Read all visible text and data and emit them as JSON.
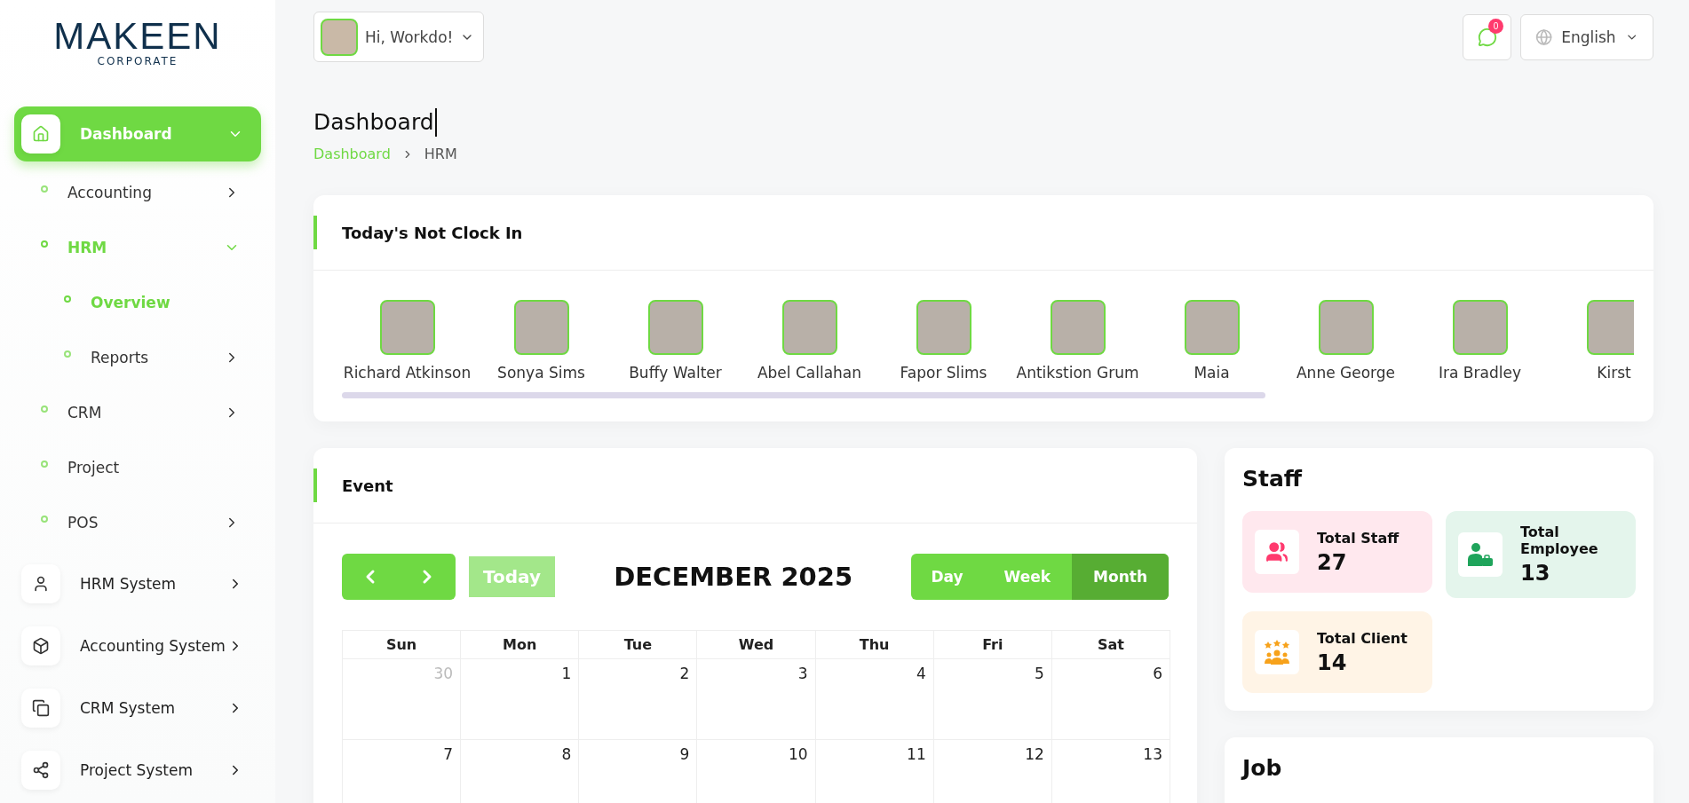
{
  "logo": {
    "name": "MAKEEN",
    "tagline": "CORPORATE"
  },
  "sidebar": {
    "items": [
      {
        "label": "Dashboard",
        "kind": "main",
        "selected": true,
        "expanded": true,
        "children": [
          {
            "label": "Accounting",
            "selected": false,
            "expanded": false,
            "has_children": true
          },
          {
            "label": "HRM",
            "selected": true,
            "expanded": true,
            "has_children": true,
            "children": [
              {
                "label": "Overview",
                "selected": true,
                "expanded": false,
                "has_children": false
              },
              {
                "label": "Reports",
                "selected": false,
                "expanded": false,
                "has_children": true
              }
            ]
          },
          {
            "label": "CRM",
            "selected": false,
            "expanded": false,
            "has_children": true
          },
          {
            "label": "Project",
            "selected": false,
            "expanded": false,
            "has_children": false
          },
          {
            "label": "POS",
            "selected": false,
            "expanded": false,
            "has_children": true
          }
        ]
      },
      {
        "label": "HRM System",
        "kind": "main",
        "selected": false,
        "expanded": false
      },
      {
        "label": "Accounting System",
        "kind": "main",
        "selected": false,
        "expanded": false
      },
      {
        "label": "CRM System",
        "kind": "main",
        "selected": false,
        "expanded": false
      },
      {
        "label": "Project System",
        "kind": "main",
        "selected": false,
        "expanded": false
      }
    ]
  },
  "topbar": {
    "user_greeting": "Hi, Workdo!",
    "notification_count": "0",
    "language": "English"
  },
  "page": {
    "title": "Dashboard",
    "breadcrumb": [
      "Dashboard",
      "HRM"
    ]
  },
  "not_clock_in": {
    "title": "Today's Not Clock In",
    "people": [
      {
        "name": "Richard Atkinson"
      },
      {
        "name": "Sonya Sims"
      },
      {
        "name": "Buffy Walter"
      },
      {
        "name": "Abel Callahan"
      },
      {
        "name": "Fapor Slims"
      },
      {
        "name": "Antikstion Grum"
      },
      {
        "name": "Maia"
      },
      {
        "name": "Anne George"
      },
      {
        "name": "Ira Bradley"
      },
      {
        "name": "Kirst"
      }
    ]
  },
  "event": {
    "title": "Event",
    "today_label": "Today",
    "month_title": "DECEMBER 2025",
    "views": [
      {
        "label": "Day",
        "selected": false
      },
      {
        "label": "Week",
        "selected": false
      },
      {
        "label": "Month",
        "selected": true
      }
    ],
    "weekdays": [
      "Sun",
      "Mon",
      "Tue",
      "Wed",
      "Thu",
      "Fri",
      "Sat"
    ],
    "weeks": [
      [
        {
          "day": "30",
          "other_month": true
        },
        {
          "day": "1",
          "other_month": false
        },
        {
          "day": "2",
          "other_month": false
        },
        {
          "day": "3",
          "other_month": false
        },
        {
          "day": "4",
          "other_month": false
        },
        {
          "day": "5",
          "other_month": false
        },
        {
          "day": "6",
          "other_month": false
        }
      ],
      [
        {
          "day": "7",
          "other_month": false
        },
        {
          "day": "8",
          "other_month": false
        },
        {
          "day": "9",
          "other_month": false
        },
        {
          "day": "10",
          "other_month": false
        },
        {
          "day": "11",
          "other_month": false
        },
        {
          "day": "12",
          "other_month": false
        },
        {
          "day": "13",
          "other_month": false
        }
      ]
    ]
  },
  "staff": {
    "title": "Staff",
    "stats": [
      {
        "label": "Total Staff",
        "value": "27",
        "color": "#ffe8ee"
      },
      {
        "label": "Total Employee",
        "value": "13",
        "color": "#e4f5ec"
      },
      {
        "label": "Total Client",
        "value": "14",
        "color": "#fff4e6"
      }
    ]
  },
  "job": {
    "title": "Job"
  }
}
